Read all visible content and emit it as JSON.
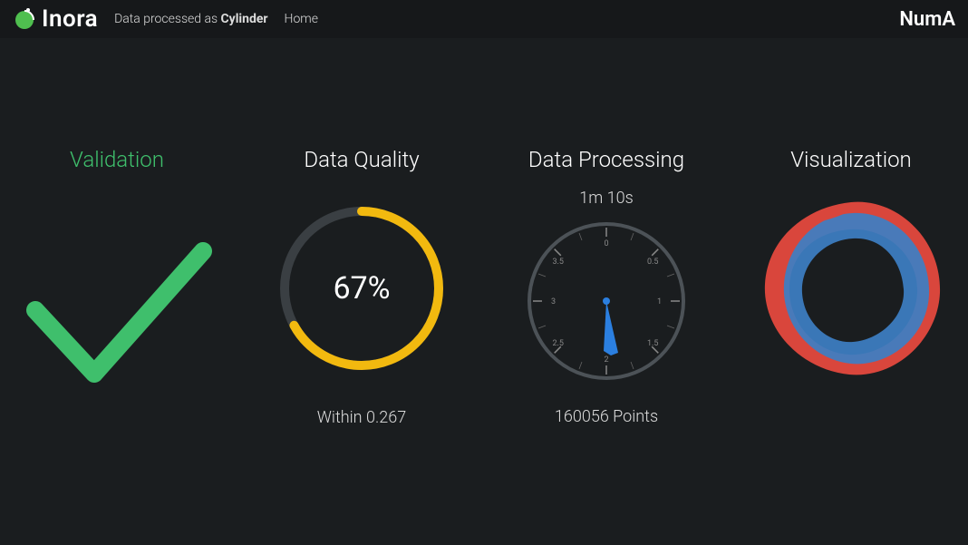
{
  "header": {
    "brand": "Inora",
    "status_prefix": "Data processed as ",
    "status_value": "Cylinder",
    "home_link": "Home",
    "app_name": "NumA"
  },
  "panels": {
    "validation": {
      "title": "Validation",
      "ok": true
    },
    "quality": {
      "title": "Data Quality",
      "percent_text": "67%",
      "percent": 67,
      "footer": "Within 0.267"
    },
    "processing": {
      "title": "Data Processing",
      "elapsed": "1m 10s",
      "footer": "160056 Points"
    },
    "visualization": {
      "title": "Visualization"
    }
  },
  "chart_data": [
    {
      "type": "gauge",
      "name": "data-quality-gauge",
      "title": "Data Quality",
      "value": 67,
      "min": 0,
      "max": 100,
      "unit": "%",
      "annotation": "Within 0.267"
    },
    {
      "type": "gauge",
      "name": "data-processing-clock",
      "title": "Data Processing",
      "value": 70,
      "unit": "seconds",
      "display": "1m 10s",
      "annotation": "160056 Points",
      "dial_labels": [
        "0",
        "0.5",
        "1",
        "1.5",
        "2",
        "2.5",
        "3",
        "3.5"
      ]
    }
  ]
}
